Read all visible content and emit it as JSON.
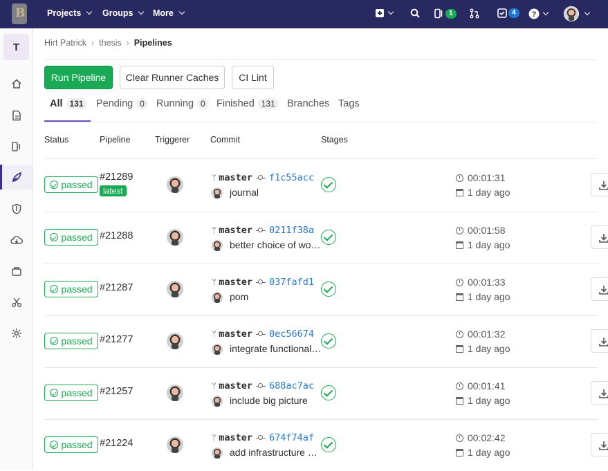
{
  "topbar": {
    "logo_letter": "B",
    "projects": "Projects",
    "groups": "Groups",
    "more": "More",
    "mr_count": "1",
    "todo_count": "4"
  },
  "sidebar": {
    "project_letter": "T",
    "items": [
      "home-icon",
      "document-icon",
      "issues-icon",
      "rocket-icon",
      "shield-icon",
      "cloud-icon",
      "package-icon",
      "scissors-icon",
      "settings-icon"
    ]
  },
  "breadcrumb": {
    "user": "Hirt Patrick",
    "project": "thesis",
    "page": "Pipelines"
  },
  "buttons": {
    "run": "Run Pipeline",
    "clear": "Clear Runner Caches",
    "lint": "CI Lint"
  },
  "tabs": [
    {
      "label": "All",
      "count": "131"
    },
    {
      "label": "Pending",
      "count": "0"
    },
    {
      "label": "Running",
      "count": "0"
    },
    {
      "label": "Finished",
      "count": "131"
    },
    {
      "label": "Branches"
    },
    {
      "label": "Tags"
    }
  ],
  "columns": {
    "status": "Status",
    "pipeline": "Pipeline",
    "triggerer": "Triggerer",
    "commit": "Commit",
    "stages": "Stages"
  },
  "pipelines": [
    {
      "status": "passed",
      "id": "#21289",
      "latest": "latest",
      "branch": "master",
      "sha": "f1c55acc",
      "message": "journal",
      "duration": "00:01:31",
      "finished": "1 day ago"
    },
    {
      "status": "passed",
      "id": "#21288",
      "branch": "master",
      "sha": "0211f38a",
      "message": "better choice of wor…",
      "duration": "00:01:58",
      "finished": "1 day ago"
    },
    {
      "status": "passed",
      "id": "#21287",
      "branch": "master",
      "sha": "037fafd1",
      "message": "pom",
      "duration": "00:01:33",
      "finished": "1 day ago"
    },
    {
      "status": "passed",
      "id": "#21277",
      "branch": "master",
      "sha": "0ec56674",
      "message": "integrate functional …",
      "duration": "00:01:32",
      "finished": "1 day ago"
    },
    {
      "status": "passed",
      "id": "#21257",
      "branch": "master",
      "sha": "688ac7ac",
      "message": "include big picture",
      "duration": "00:01:41",
      "finished": "1 day ago"
    },
    {
      "status": "passed",
      "id": "#21224",
      "branch": "master",
      "sha": "674f74af",
      "message": "add infrastructure o…",
      "duration": "00:02:42",
      "finished": "1 day ago"
    }
  ],
  "colors": {
    "topbar": "#292961",
    "success": "#1aaa55",
    "link": "#1f78d1",
    "active_tab": "#6b4fbb"
  }
}
